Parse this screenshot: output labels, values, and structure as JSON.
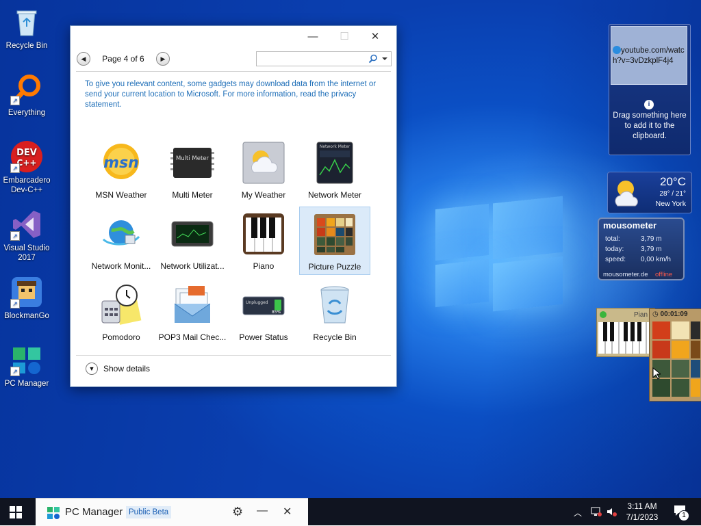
{
  "desktop": {
    "icons": [
      {
        "label": "Recycle Bin"
      },
      {
        "label": "Everything"
      },
      {
        "label": "Embarcadero Dev-C++"
      },
      {
        "label": "Visual Studio 2017"
      },
      {
        "label": "BlockmanGo"
      },
      {
        "label": "PC Manager"
      }
    ]
  },
  "gadgets_window": {
    "page_label": "Page 4 of 6",
    "search_value": "",
    "privacy_text": "To give you relevant content, some gadgets may download data from the internet or send your current location to Microsoft. For more information, read the privacy statement.",
    "gadgets": [
      {
        "label": "MSN Weather"
      },
      {
        "label": "Multi Meter"
      },
      {
        "label": "My Weather"
      },
      {
        "label": "Network Meter"
      },
      {
        "label": "Network Monit..."
      },
      {
        "label": "Network Utilizat..."
      },
      {
        "label": "Piano"
      },
      {
        "label": "Picture Puzzle",
        "selected": true
      },
      {
        "label": "Pomodoro"
      },
      {
        "label": "POP3 Mail Chec..."
      },
      {
        "label": "Power Status"
      },
      {
        "label": "Recycle Bin"
      }
    ],
    "icon_text": {
      "msn": "msn",
      "multi_meter": "Multi Meter",
      "network_meter": "Network Meter",
      "unplugged": "Unplugged",
      "battery": "85%"
    },
    "show_details_label": "Show details"
  },
  "clipboard_gadget": {
    "url": "youtube.com/watch?v=3vDzkplF4j4",
    "hint": "Drag something here to add it to the clipboard."
  },
  "weather_gadget": {
    "temp": "20°C",
    "range": "28° / 21°",
    "city": "New York"
  },
  "mousometer_gadget": {
    "title": "mousometer",
    "rows": [
      {
        "label": "total:",
        "value": "3,79 m"
      },
      {
        "label": "today:",
        "value": "3,79 m"
      },
      {
        "label": "speed:",
        "value": "0,00 km/h"
      }
    ],
    "footer": "mousometer.de",
    "status": "offline"
  },
  "piano_gadget": {
    "title": "Pian"
  },
  "puzzle_gadget": {
    "timer": "00:01:09"
  },
  "taskbar": {
    "app_title": "PC Manager",
    "badge": "Public Beta",
    "time": "3:11 AM",
    "date": "7/1/2023",
    "notifications": "1"
  },
  "colors": {
    "accent": "#1f6fb8",
    "selected_bg": "#dbeaf9"
  }
}
